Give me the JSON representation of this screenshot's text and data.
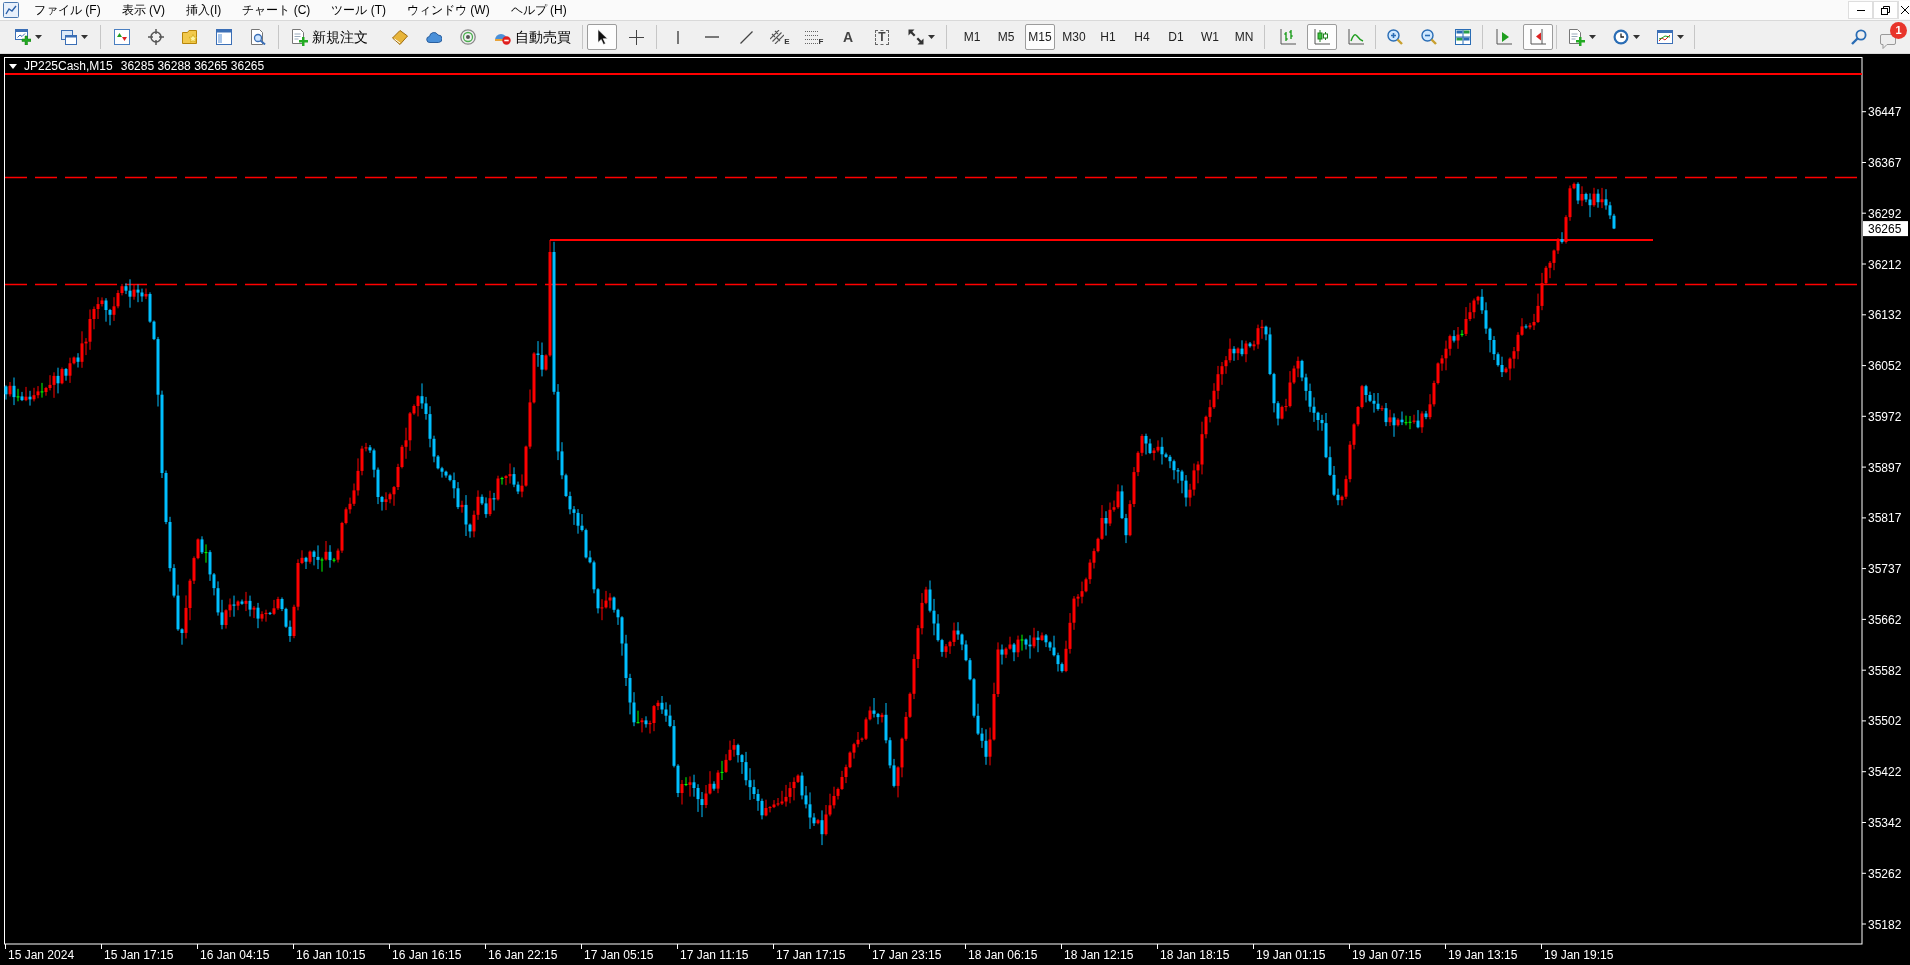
{
  "menu_bar": {
    "items": [
      "ファイル (F)",
      "表示 (V)",
      "挿入(I)",
      "チャート (C)",
      "ツール (T)",
      "ウィンドウ (W)",
      "ヘルプ (H)"
    ]
  },
  "toolbar": {
    "new_order_label": "新規注文",
    "autotrading_label": "自動売買",
    "cursor_tools": [
      {
        "kind": "cursor",
        "selected": true
      },
      {
        "kind": "crosshair",
        "selected": false
      }
    ],
    "drawing_tools": [
      {
        "kind": "vertical"
      },
      {
        "kind": "horizontal"
      },
      {
        "kind": "trend"
      },
      {
        "kind": "channel",
        "glyph": "E"
      },
      {
        "kind": "fibo",
        "glyph": "F"
      },
      {
        "kind": "text",
        "glyph": "A"
      },
      {
        "kind": "label",
        "glyph": "T"
      },
      {
        "kind": "arrows"
      }
    ],
    "timeframes": [
      {
        "label": "M1",
        "selected": false
      },
      {
        "label": "M5",
        "selected": false
      },
      {
        "label": "M15",
        "selected": true
      },
      {
        "label": "M30",
        "selected": false
      },
      {
        "label": "H1",
        "selected": false
      },
      {
        "label": "H4",
        "selected": false
      },
      {
        "label": "D1",
        "selected": false
      },
      {
        "label": "W1",
        "selected": false
      },
      {
        "label": "MN",
        "selected": false
      }
    ],
    "chart_types": [
      {
        "kind": "bars",
        "selected": false
      },
      {
        "kind": "candles",
        "selected": true
      },
      {
        "kind": "line",
        "selected": false
      }
    ],
    "auto_scroll": false,
    "chart_shift": true,
    "notification_count": "1"
  },
  "chart": {
    "symbol": "JP225Cash,M15",
    "quote": "36285 36288 36265 36265",
    "current_price": "36265",
    "price_axis": [
      "36447",
      "36367",
      "36292",
      "36212",
      "36132",
      "36052",
      "35972",
      "35897",
      "35817",
      "35737",
      "35662",
      "35582",
      "35502",
      "35422",
      "35342",
      "35262",
      "35182"
    ],
    "time_axis": [
      "15 Jan 2024",
      "15 Jan 17:15",
      "16 Jan 04:15",
      "16 Jan 10:15",
      "16 Jan 16:15",
      "16 Jan 22:15",
      "17 Jan 05:15",
      "17 Jan 11:15",
      "17 Jan 17:15",
      "17 Jan 23:15",
      "18 Jan 06:15",
      "18 Jan 12:15",
      "18 Jan 18:15",
      "19 Jan 01:15",
      "19 Jan 07:15",
      "19 Jan 13:15",
      "19 Jan 19:15"
    ]
  }
}
